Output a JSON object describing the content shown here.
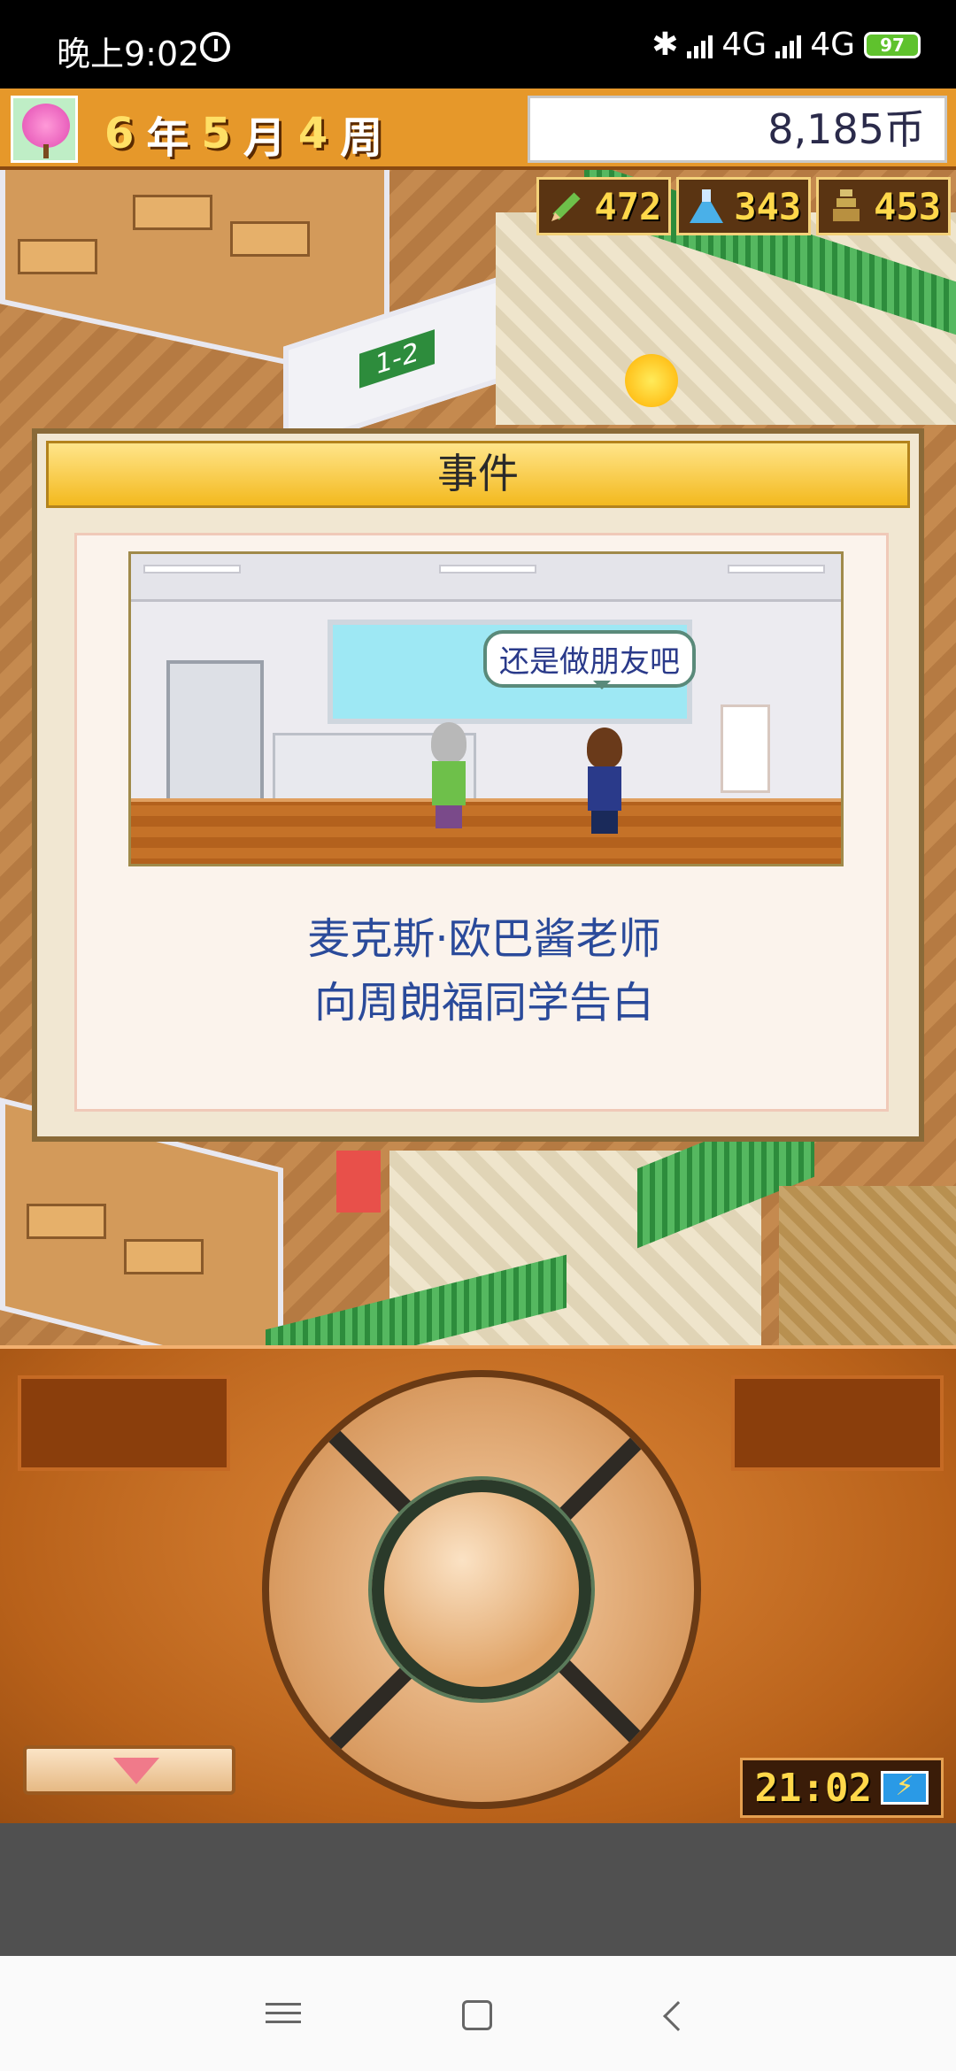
{
  "status_bar": {
    "time": "晚上9:02",
    "network1": "4G",
    "network2": "4G",
    "battery": "97"
  },
  "hud": {
    "year": "6",
    "year_unit": "年",
    "month": "5",
    "month_unit": "月",
    "week": "4",
    "week_unit": "周",
    "coins": "8,185币",
    "stats": [
      {
        "icon": "pencil-icon",
        "value": "472"
      },
      {
        "icon": "flask-icon",
        "value": "343"
      },
      {
        "icon": "trophy-icon",
        "value": "453"
      }
    ]
  },
  "event": {
    "title": "事件",
    "speech": "还是做朋友吧",
    "message_line1": "麦克斯·欧巴酱老师",
    "message_line2": "向周朗福同学告白"
  },
  "game_board": {
    "classroom_sign": "1-2"
  },
  "controller": {
    "clock": "21:02"
  },
  "colors": {
    "hud_orange": "#e6982a",
    "dialog_title": "#f3b91e",
    "message_text": "#2a4a9a",
    "stat_digits": "#ffd84a"
  }
}
